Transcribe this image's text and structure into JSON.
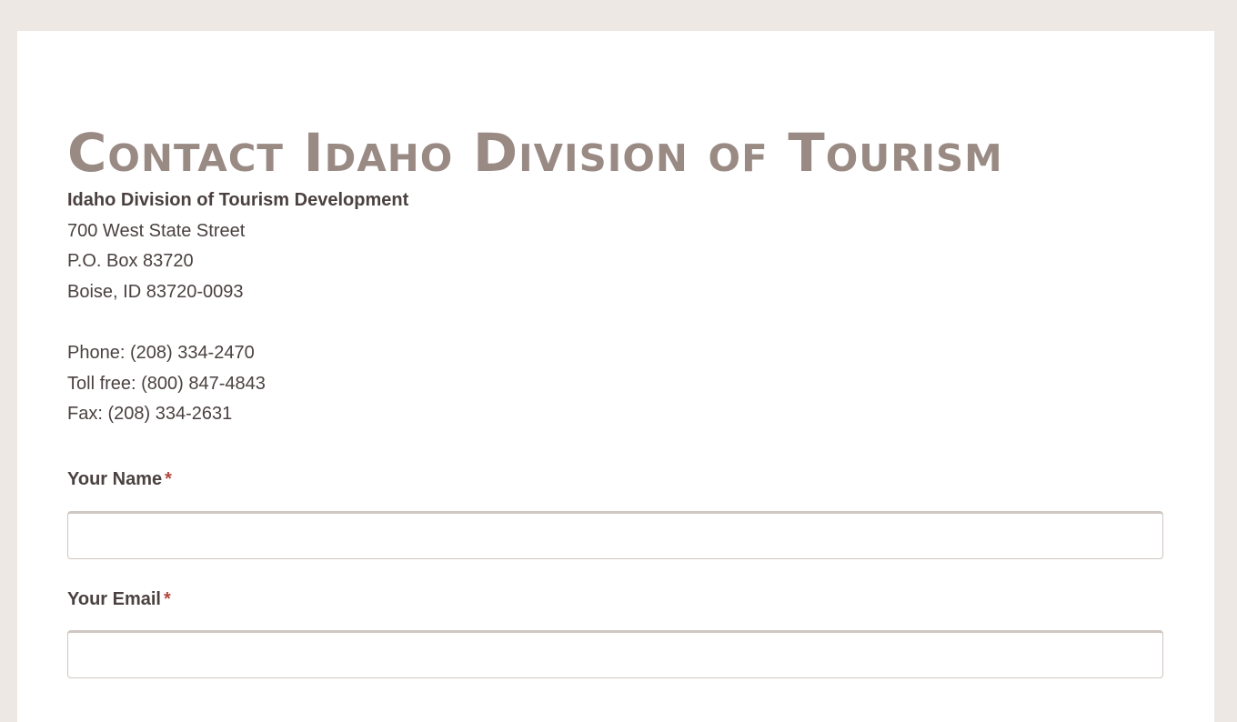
{
  "page": {
    "title": "Contact Idaho Division of Tourism"
  },
  "address": {
    "organization": "Idaho Division of Tourism Development",
    "street": "700 West State Street",
    "po_box": "P.O. Box 83720",
    "city_state_zip": "Boise, ID 83720-0093",
    "phone": "Phone: (208) 334-2470",
    "toll_free": "Toll free: (800) 847-4843",
    "fax": "Fax: (208) 334-2631"
  },
  "form": {
    "name_label": "Your Name",
    "name_value": "",
    "email_label": "Your Email",
    "email_value": "",
    "required_marker": "*"
  },
  "colors": {
    "background": "#ede8e3",
    "card": "#ffffff",
    "title": "#9a8a84",
    "text": "#4a4140",
    "required": "#b5473f",
    "input_border": "#cfc7c2"
  }
}
